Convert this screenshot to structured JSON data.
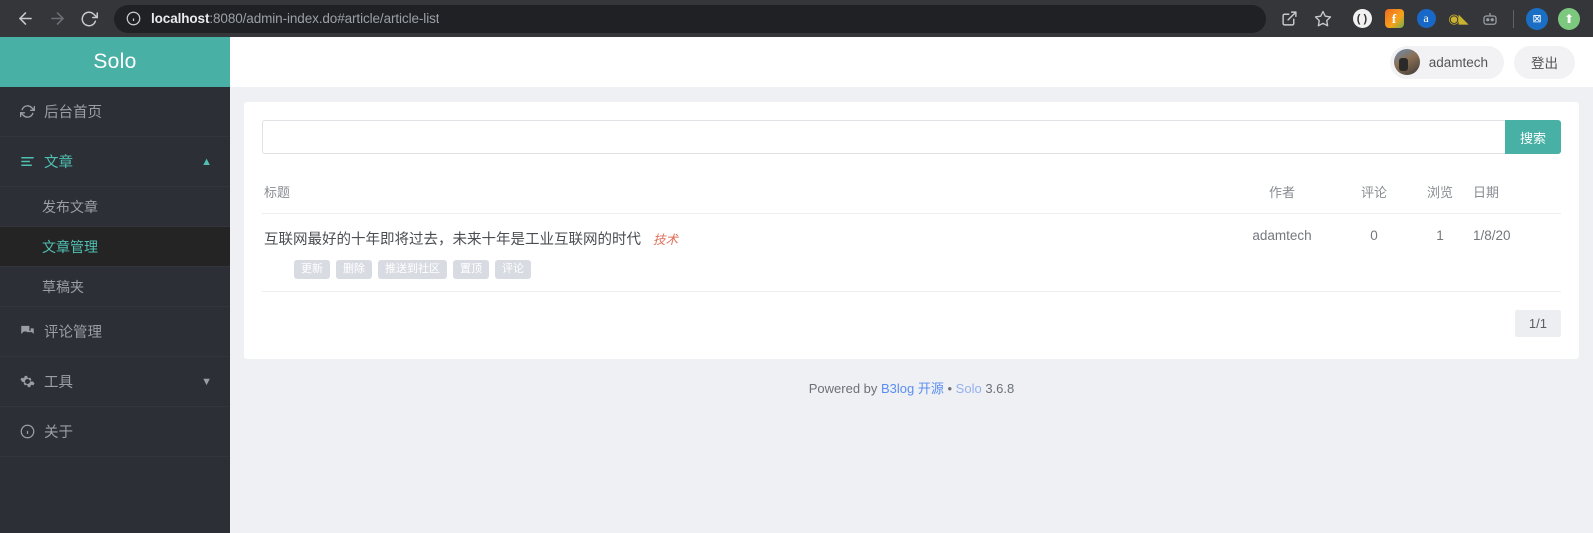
{
  "browser": {
    "back_icon": "back-arrow-icon",
    "forward_icon": "forward-arrow-icon",
    "reload_icon": "reload-icon",
    "info_icon": "info-circle-icon",
    "url_host": "localhost",
    "url_rest": ":8080/admin-index.do#article/article-list",
    "share_icon": "share-icon",
    "bookmark_icon": "star-icon",
    "extensions": [
      {
        "name": "extension-circle-icon",
        "glyph": "( )"
      },
      {
        "name": "extension-flash-icon",
        "glyph": "f"
      },
      {
        "name": "extension-alexa-icon",
        "glyph": "a"
      },
      {
        "name": "extension-goggles-icon",
        "glyph": "◉◣"
      },
      {
        "name": "extension-robot-icon",
        "glyph": "robot"
      },
      {
        "name": "extension-blue-square-icon",
        "glyph": "⊠"
      },
      {
        "name": "extension-green-upload-icon",
        "glyph": "⬆"
      }
    ]
  },
  "sidebar": {
    "brand": "Solo",
    "items": [
      {
        "label": "后台首页",
        "icon": "refresh-icon",
        "accent": false,
        "caret": ""
      },
      {
        "label": "文章",
        "icon": "list-icon",
        "accent": true,
        "caret": "▲"
      },
      {
        "label": "评论管理",
        "icon": "comments-icon",
        "accent": false,
        "caret": ""
      },
      {
        "label": "工具",
        "icon": "gear-icon",
        "accent": false,
        "caret": "▼"
      },
      {
        "label": "关于",
        "icon": "info-icon",
        "accent": false,
        "caret": ""
      }
    ],
    "sub_items": [
      {
        "label": "发布文章",
        "active": false
      },
      {
        "label": "文章管理",
        "active": true
      },
      {
        "label": "草稿夹",
        "active": false
      }
    ]
  },
  "topbar": {
    "user_name": "adamtech",
    "logout_label": "登出"
  },
  "search": {
    "value": "",
    "placeholder": "",
    "button_label": "搜索"
  },
  "table": {
    "headers": {
      "title": "标题",
      "author": "作者",
      "comment": "评论",
      "view": "浏览",
      "date": "日期"
    },
    "rows": [
      {
        "title": "互联网最好的十年即将过去，未来十年是工业互联网的时代",
        "tag": "技术",
        "actions": [
          "更新",
          "删除",
          "推送到社区",
          "置顶",
          "评论"
        ],
        "author": "adamtech",
        "comment": "0",
        "view": "1",
        "date": "1/8/20"
      }
    ]
  },
  "pagination": {
    "label": "1/1"
  },
  "footer": {
    "prefix": "Powered by ",
    "link1": "B3log",
    "link1_suffix": " 开源",
    "separator": " • ",
    "link2": "Solo",
    "version": " 3.6.8"
  },
  "colors": {
    "brand_teal": "#48b0a4",
    "sidebar_bg": "#2d2f36",
    "accent_text": "#4fc0b2",
    "tag_red": "#e0715c",
    "link_blue": "#5b8ef0"
  }
}
